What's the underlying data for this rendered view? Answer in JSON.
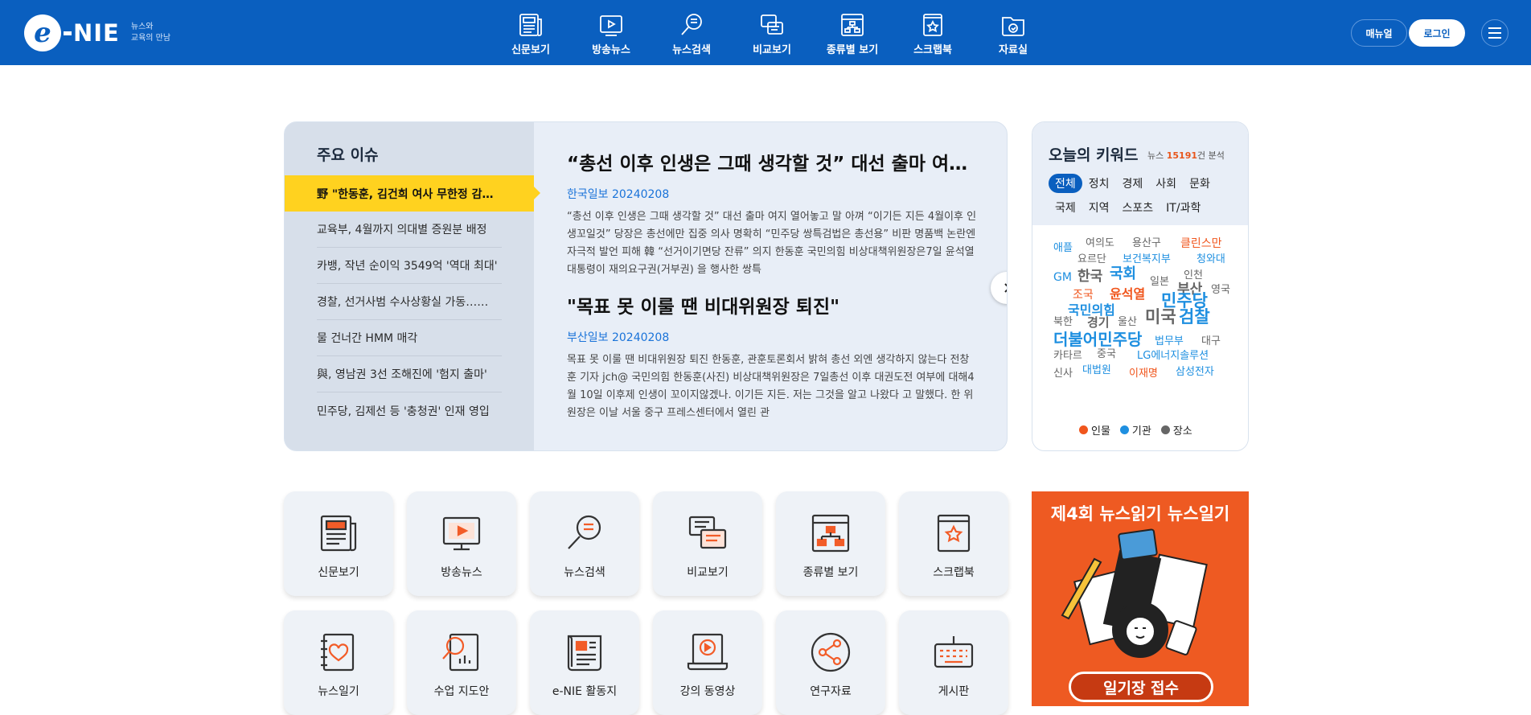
{
  "header": {
    "logo_mark": "e",
    "logo_text": "NIE",
    "tagline_line1": "뉴스와",
    "tagline_line2": "교육의 만남",
    "nav": [
      {
        "label": "신문보기",
        "icon": "newspaper-icon"
      },
      {
        "label": "방송뉴스",
        "icon": "tv-icon"
      },
      {
        "label": "뉴스검색",
        "icon": "search-icon"
      },
      {
        "label": "비교보기",
        "icon": "compare-icon"
      },
      {
        "label": "종류별 보기",
        "icon": "category-icon"
      },
      {
        "label": "스크랩북",
        "icon": "scrapbook-icon"
      },
      {
        "label": "자료실",
        "icon": "archive-icon"
      }
    ],
    "manual_label": "매뉴얼",
    "login_label": "로그인"
  },
  "issues": {
    "title": "주요 이슈",
    "items": [
      "野 \"한동훈, 김건희 여사 무한정 감싸기\"",
      "교육부, 4월까지 의대별 증원분 배정",
      "카뱅, 작년 순이익 3549억 '역대 최대'",
      "경찰, 선거사범 수사상황실 가동……",
      "물 건너간 HMM 매각",
      "與, 영남권 3선 조해진에 '험지 출마'",
      "민주당, 김제선 등 '충청권' 인재 영입"
    ],
    "articles": [
      {
        "title": "“총선 이후 인생은 그때 생각할 것” 대선 출마 여지 열어놓고",
        "source": "한국일보 20240208",
        "body": "“총선 이후 인생은 그때 생각할 것” 대선 출마 여지 열어놓고 말 아껴 “이기든 지든 4월이후 인생꼬일것” 당장은 총선에만 집중 의사 명확히 “민주당 쌍특검법은 총선용” 비판 명품백 논란엔 자극적 발언 피해 韓 “선거이기면당 잔류” 의지 한동훈 국민의힘 비상대책위원장은7일 윤석열 대통령이 재의요구권(거부권) 을 행사한 쌍특"
      },
      {
        "title": "\"목표 못 이룰 땐 비대위원장 퇴진\"",
        "source": "부산일보 20240208",
        "body": "목표 못 이룰 땐 비대위원장 퇴진 한동훈, 관훈토론회서 밝혀 총선 외엔 생각하지 않는다 전창훈 기자 jch@ 국민의힘 한동훈(사진) 비상대책위원장은 7일총선 이후 대권도전 여부에 대해4월 10일 이후제 인생이 꼬이지않겠나. 이기든 지든. 저는 그것을 알고 나왔다 고 말했다. 한 위원장은 이날 서울 중구 프레스센터에서 열린 관"
      }
    ]
  },
  "keywords": {
    "title": "오늘의 키워드",
    "meta_prefix": "뉴스",
    "meta_count": "15191",
    "meta_suffix": "건 분석",
    "tabs": [
      "전체",
      "정치",
      "경제",
      "사회",
      "문화",
      "국제",
      "지역",
      "스포츠",
      "IT/과학"
    ],
    "active_tab": "전체",
    "colors": {
      "person": "#f0561d",
      "org": "#1e8fe0",
      "place": "#666666"
    },
    "cloud": [
      {
        "word": "애플",
        "type": "org"
      },
      {
        "word": "여의도",
        "type": "place"
      },
      {
        "word": "용산구",
        "type": "place"
      },
      {
        "word": "클린스만",
        "type": "person"
      },
      {
        "word": "요르단",
        "type": "place"
      },
      {
        "word": "보건복지부",
        "type": "org"
      },
      {
        "word": "청와대",
        "type": "org"
      },
      {
        "word": "GM",
        "type": "org"
      },
      {
        "word": "한국",
        "type": "place"
      },
      {
        "word": "국회",
        "type": "org"
      },
      {
        "word": "일본",
        "type": "place"
      },
      {
        "word": "인천",
        "type": "place"
      },
      {
        "word": "부산",
        "type": "place"
      },
      {
        "word": "영국",
        "type": "place"
      },
      {
        "word": "조국",
        "type": "person"
      },
      {
        "word": "윤석열",
        "type": "person"
      },
      {
        "word": "민주당",
        "type": "org"
      },
      {
        "word": "국민의힘",
        "type": "org"
      },
      {
        "word": "미국",
        "type": "place"
      },
      {
        "word": "검찰",
        "type": "org"
      },
      {
        "word": "북한",
        "type": "place"
      },
      {
        "word": "경기",
        "type": "place"
      },
      {
        "word": "울산",
        "type": "place"
      },
      {
        "word": "더불어민주당",
        "type": "org"
      },
      {
        "word": "법무부",
        "type": "org"
      },
      {
        "word": "대구",
        "type": "place"
      },
      {
        "word": "카타르",
        "type": "place"
      },
      {
        "word": "중국",
        "type": "place"
      },
      {
        "word": "LG에너지솔루션",
        "type": "org"
      },
      {
        "word": "신사",
        "type": "place"
      },
      {
        "word": "대법원",
        "type": "org"
      },
      {
        "word": "이재명",
        "type": "person"
      },
      {
        "word": "삼성전자",
        "type": "org"
      }
    ],
    "legend": [
      {
        "label": "인물",
        "color": "#f0561d"
      },
      {
        "label": "기관",
        "color": "#1e8fe0"
      },
      {
        "label": "장소",
        "color": "#666666"
      }
    ]
  },
  "quick_menu": [
    {
      "label": "신문보기",
      "icon": "newspaper-icon"
    },
    {
      "label": "방송뉴스",
      "icon": "tv-icon"
    },
    {
      "label": "뉴스검색",
      "icon": "search-icon"
    },
    {
      "label": "비교보기",
      "icon": "compare-icon"
    },
    {
      "label": "종류별 보기",
      "icon": "category-icon"
    },
    {
      "label": "스크랩북",
      "icon": "scrapbook-icon"
    },
    {
      "label": "뉴스일기",
      "icon": "diary-icon"
    },
    {
      "label": "수업 지도안",
      "icon": "lesson-plan-icon"
    },
    {
      "label": "e-NIE 활동지",
      "icon": "worksheet-icon"
    },
    {
      "label": "강의 동영상",
      "icon": "video-lecture-icon"
    },
    {
      "label": "연구자료",
      "icon": "share-icon"
    },
    {
      "label": "게시판",
      "icon": "keyboard-icon"
    }
  ],
  "banner": {
    "title": "제4회 뉴스읽기 뉴스일기",
    "button_label": "일기장 접수"
  }
}
